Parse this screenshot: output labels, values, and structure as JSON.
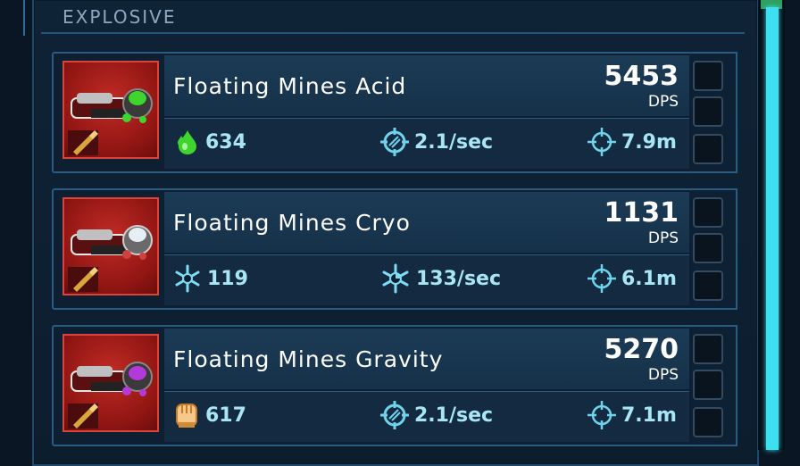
{
  "section": {
    "title": "EXPLOSIVE"
  },
  "weapons": [
    {
      "name": "Floating Mines Acid",
      "dps": "5453",
      "dps_label": "DPS",
      "damage": "634",
      "damage_icon": "acid-drop-icon",
      "rate": "2.1/sec",
      "rate_icon": "fire-rate-icon",
      "range": "7.9m",
      "range_icon": "crosshair-icon",
      "accent": "#3fd42e"
    },
    {
      "name": "Floating Mines Cryo",
      "dps": "1131",
      "dps_label": "DPS",
      "damage": "119",
      "damage_icon": "snowflake-icon",
      "rate": "133/sec",
      "rate_icon": "cryo-rate-icon",
      "range": "6.1m",
      "range_icon": "crosshair-icon",
      "accent": "#d9e6ef"
    },
    {
      "name": "Floating Mines Gravity",
      "dps": "5270",
      "dps_label": "DPS",
      "damage": "617",
      "damage_icon": "fist-icon",
      "rate": "2.1/sec",
      "rate_icon": "fire-rate-icon",
      "range": "7.1m",
      "range_icon": "crosshair-icon",
      "accent": "#b33ad8"
    }
  ],
  "colors": {
    "stat_text": "#a9e6f5",
    "scrollbar": "#3ee0ef",
    "card_border": "#2a5b80"
  }
}
